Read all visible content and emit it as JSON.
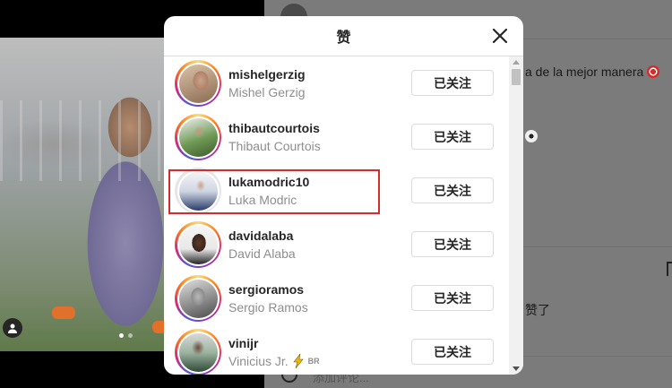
{
  "background": {
    "caption_fragment": "a de la mejor manera",
    "likes_fragment": "赞了",
    "comment_placeholder": "添加评论..."
  },
  "modal": {
    "title": "赞",
    "close_icon": "close-icon",
    "follow_label": "已关注",
    "users": [
      {
        "username": "mishelgerzig",
        "full_name": "Mishel Gerzig",
        "story_ring": true
      },
      {
        "username": "thibautcourtois",
        "full_name": "Thibaut Courtois",
        "story_ring": true
      },
      {
        "username": "lukamodric10",
        "full_name": "Luka Modric",
        "story_ring": false,
        "highlighted": true
      },
      {
        "username": "davidalaba",
        "full_name": "David Alaba",
        "story_ring": true
      },
      {
        "username": "sergioramos",
        "full_name": "Sergio Ramos",
        "story_ring": true
      },
      {
        "username": "vinijr",
        "full_name": "Vinicius Jr.",
        "story_ring": true,
        "badge": "BR"
      }
    ]
  },
  "colors": {
    "highlight": "#d62b2b",
    "secondary_text": "#8e8e8e",
    "primary_text": "#262626"
  }
}
